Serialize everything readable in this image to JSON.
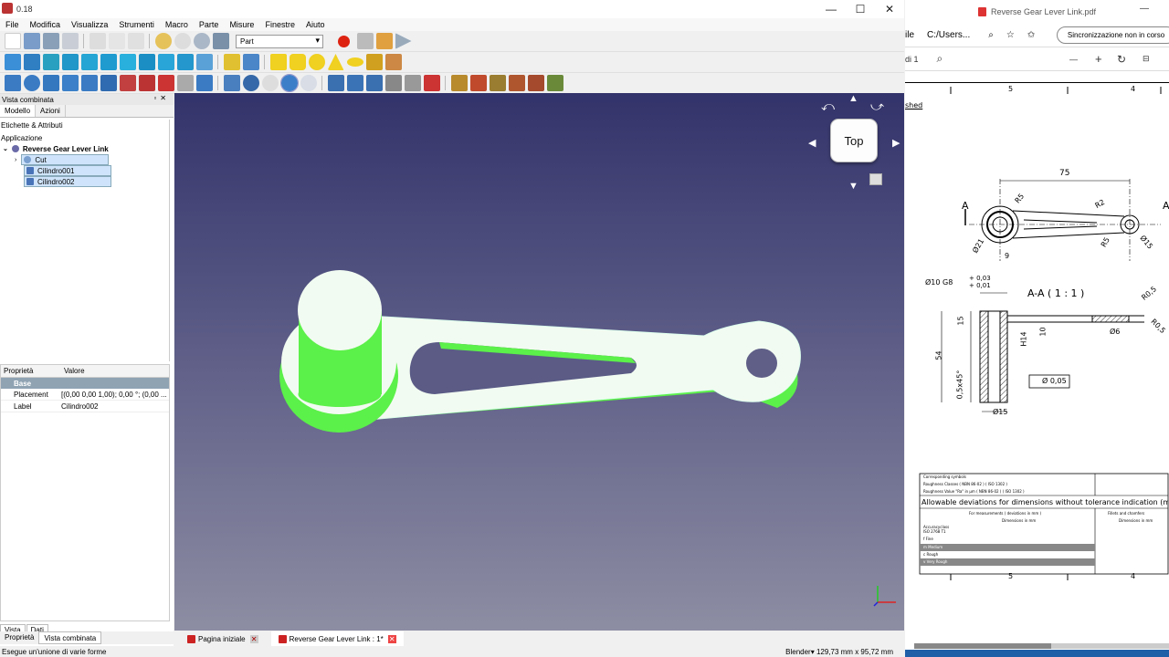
{
  "freecad": {
    "title": "0.18",
    "menu": [
      "File",
      "Modifica",
      "Visualizza",
      "Strumenti",
      "Macro",
      "Parte",
      "Misure",
      "Finestre",
      "Aiuto"
    ],
    "workbench": "Part",
    "combo": {
      "panel_title": "Vista combinata",
      "tabs": [
        "Modello",
        "Azioni"
      ],
      "tree": {
        "labels_header": "Etichette & Attributi",
        "application": "Applicazione",
        "document": "Reverse Gear Lever Link",
        "items": [
          "Cut",
          "Cilindro001",
          "Cilindro002"
        ]
      },
      "properties": {
        "col_property": "Proprietà",
        "col_value": "Valore",
        "group": "Base",
        "rows": [
          {
            "name": "Placement",
            "value": "[(0,00 0,00 1,00); 0,00 °; (0,00 ..."
          },
          {
            "name": "Label",
            "value": "Cilindro002"
          }
        ]
      },
      "view_tabs": [
        "Vista",
        "Dati"
      ],
      "bottom_tabs": [
        "Proprietà",
        "Vista combinata"
      ]
    },
    "navcube_face": "Top",
    "doc_tabs": [
      "Pagina iniziale",
      "Reverse Gear Lever Link : 1*"
    ],
    "status_left": "Esegue un'unione di varie forme",
    "status_right": "Blender▾  129,73 mm x 95,72 mm"
  },
  "pdf": {
    "tab_title": "Reverse Gear Lever Link.pdf",
    "addr_partial": "ile",
    "addr": "C:/Users...",
    "sync_label": "Sincronizzazione non in corso",
    "page_label": "di 1",
    "drawing": {
      "shed": "shed",
      "zone_top_left": "5",
      "zone_top_right": "4",
      "dim_75": "75",
      "section_label": "A",
      "section_title": "A-A ( 1 : 1 )",
      "fit": "Ø10 G8",
      "tol_up": "+ 0,03",
      "tol_dn": "+ 0,01",
      "r5": "R5",
      "r2": "R2",
      "r05": "R0,5",
      "d21": "Ø21",
      "d15": "Ø15",
      "d6": "Ø6",
      "dim9": "9",
      "dim15": "15",
      "dim54": "54",
      "dim10": "10",
      "h14": "H14",
      "chamfer": "0,5x45°",
      "perp": "Ø 0,05",
      "table_title": "Allowable deviations for dimensions without tolerance indication (mach",
      "corresponding": "Corresponding symbols",
      "roughness1": "Roughness Classes ( NBN 86-02 ) ( ISO 1302 )",
      "roughness2": "Roughness Value \"Ra\" in µm ( NBN 86-02 ) ( ISO 1302 )",
      "meas": "For measurements ( deviations in mm )",
      "fillets": "Fillets and chamfers",
      "dims_mm": "Dimensions in mm",
      "accuracy": "Accuracyclass ISO 2768 T1",
      "classes": [
        "f Fine",
        "m Medium",
        "c Rough",
        "v Very Rough"
      ]
    }
  },
  "colors": {
    "part_green": "#5cf04a",
    "part_white": "#f2fbf1",
    "viewport_top": "#33336b",
    "viewport_bottom": "#8d8da3"
  }
}
